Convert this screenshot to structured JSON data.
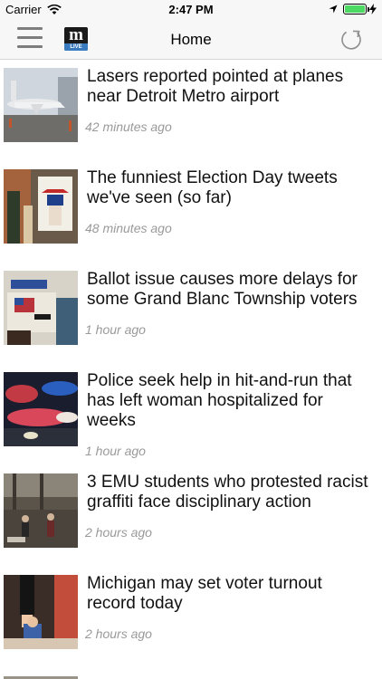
{
  "status_bar": {
    "carrier": "Carrier",
    "time": "2:47 PM",
    "battery_level": 1.0,
    "battery_color": "#4cd964"
  },
  "nav": {
    "title": "Home",
    "menu_icon": "hamburger-menu-icon",
    "refresh_icon": "refresh-icon",
    "logo": {
      "letter": "m",
      "sub": "LIVE"
    }
  },
  "articles": [
    {
      "title": "Lasers reported pointed at planes near Detroit Metro airport",
      "time": "42 minutes ago",
      "image": "airplane at airport gate"
    },
    {
      "title": "The funniest Election Day tweets we've seen (so far)",
      "time": "48 minutes ago",
      "image": "Uncle Sam vote sign"
    },
    {
      "title": "Ballot issue causes more delays for some Grand Blanc Township voters",
      "time": "1 hour ago",
      "image": "voting booth"
    },
    {
      "title": "Police seek help in hit-and-run that has left woman hospitalized for weeks",
      "time": "1 hour ago",
      "image": "police lights"
    },
    {
      "title": "3 EMU students who protested racist graffiti face disciplinary action",
      "time": "2 hours ago",
      "image": "students gathering in hall"
    },
    {
      "title": "Michigan may set voter turnout record today",
      "time": "2 hours ago",
      "image": "child at polling place"
    }
  ]
}
